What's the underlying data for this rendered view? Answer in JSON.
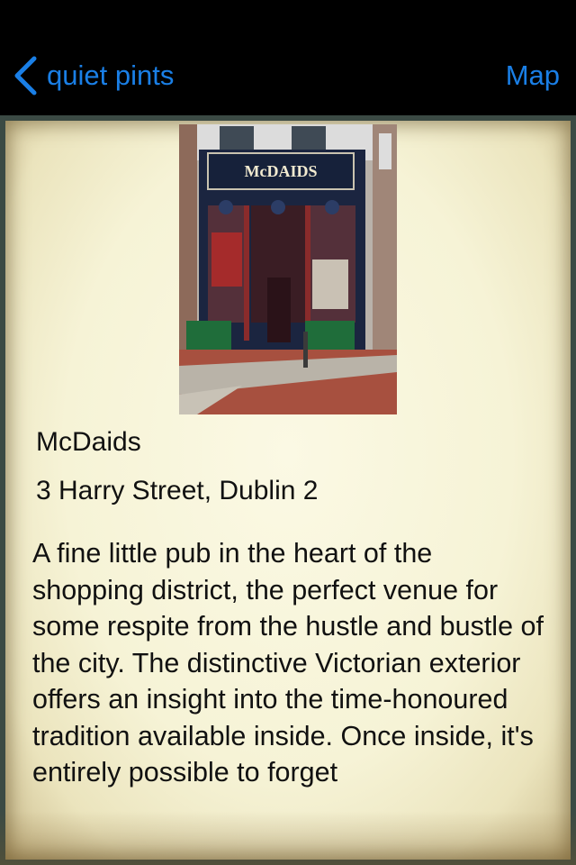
{
  "colors": {
    "accent": "#1a7fe6",
    "navbar_bg": "#000000",
    "paper": "#f7f4da"
  },
  "navbar": {
    "back_label": "quiet pints",
    "back_icon": "chevron-left-icon",
    "map_label": "Map"
  },
  "pub": {
    "photo_sign": "McDAIDS",
    "name": "McDaids",
    "address": "3 Harry Street, Dublin 2",
    "description": "A fine little pub in the heart of the shopping district, the perfect venue for some respite from the hustle and bustle of the city. The distinctive Victorian exterior offers an insight into the time-honoured tradition available inside. Once inside, it's entirely possible to forget"
  }
}
